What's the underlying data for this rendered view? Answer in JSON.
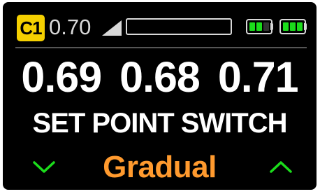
{
  "status_bar": {
    "channel": "C1",
    "value": "0.70",
    "signal_icon": "signal-strength-icon",
    "level_fraction": 0.0,
    "battery_1": {
      "icon": "battery-icon",
      "cells_filled": 2,
      "cells_total": 3
    },
    "battery_2": {
      "icon": "battery-icon",
      "cells_filled": 3,
      "cells_total": 3
    }
  },
  "readings": [
    "0.69",
    "0.68",
    "0.71"
  ],
  "menu": {
    "title": "SET POINT SWITCH",
    "selected": "Gradual",
    "down_icon": "chevron-down-icon",
    "up_icon": "chevron-up-icon"
  },
  "colors": {
    "badge": "#f5d000",
    "battery_ok": "#1bdc1b",
    "arrows": "#1bdc1b",
    "selected_value": "#ff9a2e",
    "text": "#ffffff",
    "background": "#000000"
  }
}
